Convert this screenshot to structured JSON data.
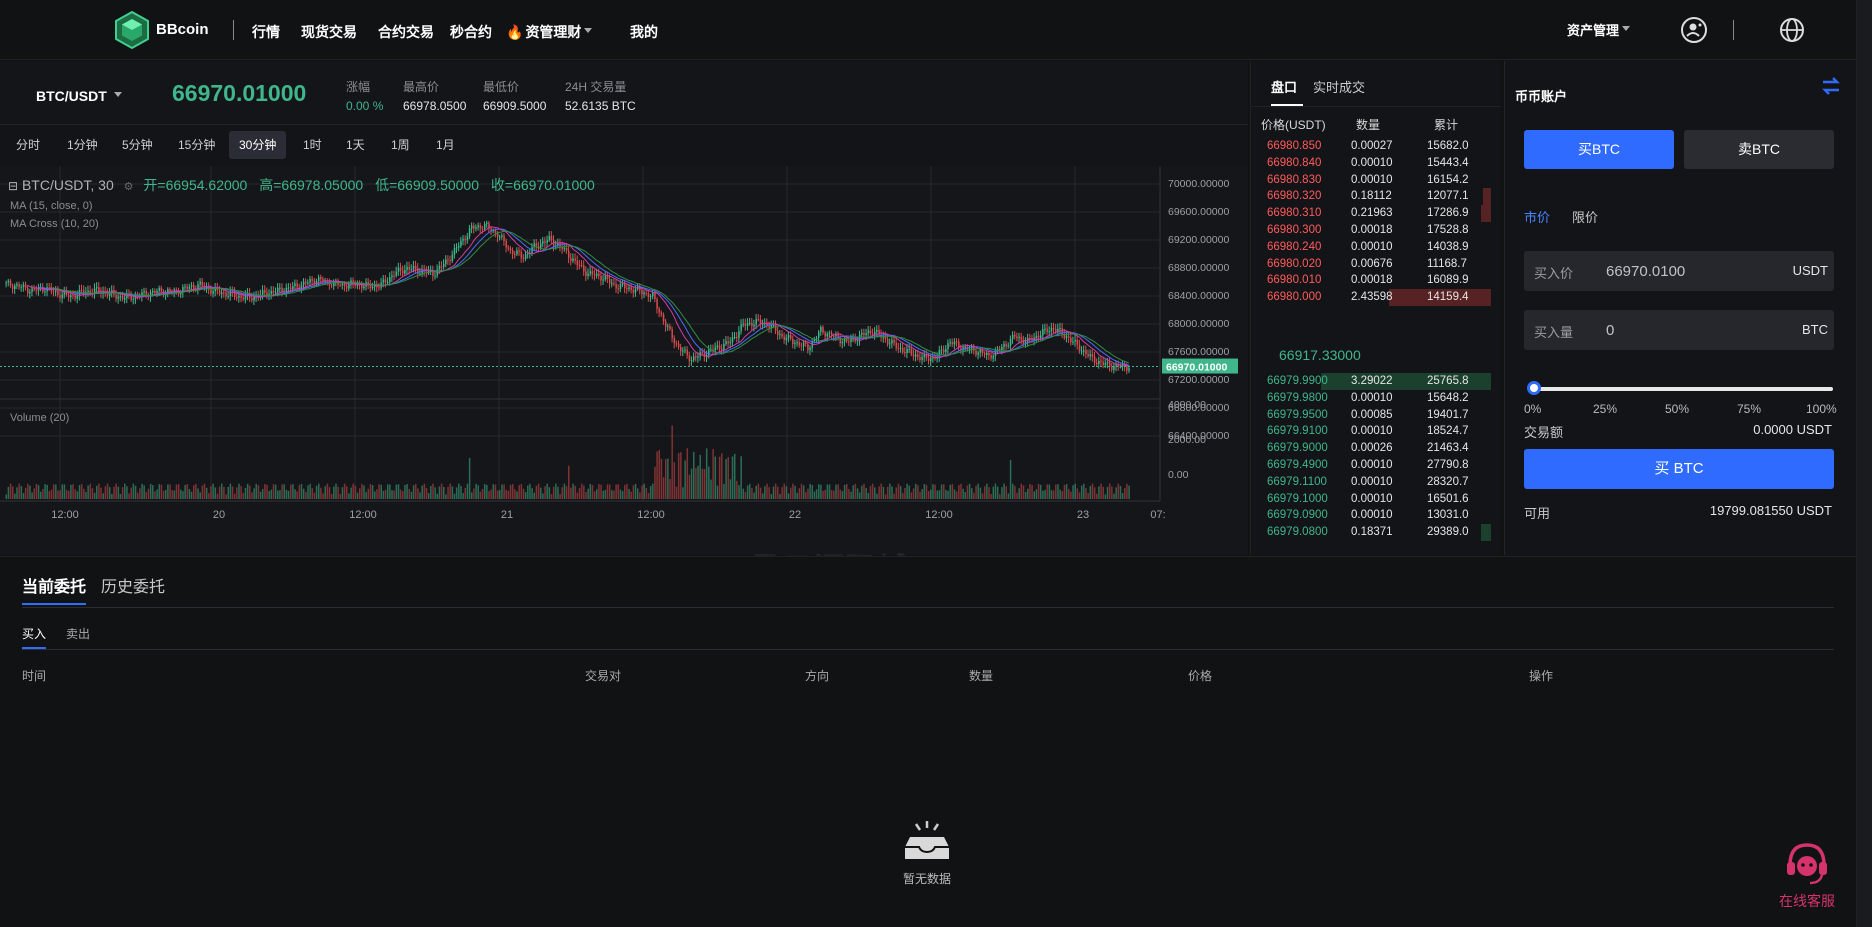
{
  "colors": {
    "up": "#3fb68b",
    "down": "#ff5b5b",
    "accent": "#2f6bff",
    "support": "#d6336c"
  },
  "nav": {
    "brand": "BBcoin",
    "items": [
      "行情",
      "现货交易",
      "合约交易",
      "秒合约",
      "资管理财",
      "我的"
    ],
    "asset_menu": "资产管理"
  },
  "ticker": {
    "pair": "BTC/USDT",
    "last_price": "66970.01000",
    "change_label": "涨幅",
    "change_value": "0.00 %",
    "high_label": "最高价",
    "high_value": "66978.0500",
    "low_label": "最低价",
    "low_value": "66909.5000",
    "vol_label": "24H 交易量",
    "vol_value": "52.6135 BTC"
  },
  "intervals": [
    "分时",
    "1分钟",
    "5分钟",
    "15分钟",
    "30分钟",
    "1时",
    "1天",
    "1周",
    "1月"
  ],
  "active_interval": "30分钟",
  "chart": {
    "legend_symbol": "BTC/USDT, 30",
    "open": "开=66954.62000",
    "high": "高=66978.05000",
    "low": "低=66909.50000",
    "close": "收=66970.01000",
    "ma_line": "MA (15, close, 0)",
    "ma_cross": "MA Cross (10, 20)",
    "volume_label": "Volume (20)",
    "price_ticks": [
      "70000.00000",
      "69600.00000",
      "69200.00000",
      "68800.00000",
      "68400.00000",
      "68000.00000",
      "67600.00000",
      "67200.00000",
      "66800.00000",
      "66400.00000"
    ],
    "last_tag": "66970.01000",
    "volume_ticks": [
      "4000.00",
      "2000.00",
      "0.00"
    ],
    "time_ticks": [
      "12:00",
      "20",
      "12:00",
      "21",
      "12:00",
      "22",
      "12:00",
      "23",
      "07:"
    ],
    "watermark": "星云源码城  fjinguo.com"
  },
  "chart_data": {
    "type": "candlestick",
    "title": "BTC/USDT, 30",
    "ylim": [
      66400,
      70000
    ],
    "x_ticks": [
      "12:00",
      "20",
      "12:00",
      "21",
      "12:00",
      "22",
      "12:00",
      "23",
      "07:"
    ],
    "close_path": [
      68420,
      68380,
      68300,
      68350,
      68250,
      68200,
      68280,
      68300,
      68250,
      68180,
      68200,
      68260,
      68300,
      68280,
      68350,
      68400,
      68300,
      68250,
      68200,
      68180,
      68250,
      68300,
      68350,
      68420,
      68500,
      68450,
      68400,
      68420,
      68380,
      68400,
      68600,
      68700,
      68650,
      68600,
      68800,
      69100,
      69400,
      69450,
      69300,
      69000,
      68900,
      69100,
      69200,
      69050,
      68800,
      68600,
      68550,
      68400,
      68350,
      68300,
      68200,
      67700,
      67300,
      67100,
      67200,
      67300,
      67400,
      67700,
      67750,
      67700,
      67500,
      67400,
      67300,
      67600,
      67500,
      67400,
      67500,
      67600,
      67450,
      67300,
      67200,
      67100,
      67150,
      67400,
      67300,
      67250,
      67150,
      67300,
      67500,
      67400,
      67550,
      67650,
      67500,
      67300,
      67100,
      67000,
      66970
    ],
    "volume_ylim": [
      0,
      4000
    ]
  },
  "book": {
    "tabs": [
      "盘口",
      "实时成交"
    ],
    "headers": [
      "价格(USDT)",
      "数量",
      "累计"
    ],
    "asks": [
      {
        "p": "66980.850",
        "q": "0.00027",
        "t": "15682.0",
        "d": 0
      },
      {
        "p": "66980.840",
        "q": "0.00010",
        "t": "15443.4",
        "d": 0
      },
      {
        "p": "66980.830",
        "q": "0.00010",
        "t": "16154.2",
        "d": 0
      },
      {
        "p": "66980.320",
        "q": "0.18112",
        "t": "12077.1",
        "d": 0.05
      },
      {
        "p": "66980.310",
        "q": "0.21963",
        "t": "17286.9",
        "d": 0.06
      },
      {
        "p": "66980.300",
        "q": "0.00018",
        "t": "17528.8",
        "d": 0
      },
      {
        "p": "66980.240",
        "q": "0.00010",
        "t": "14038.9",
        "d": 0
      },
      {
        "p": "66980.020",
        "q": "0.00676",
        "t": "11168.7",
        "d": 0
      },
      {
        "p": "66980.010",
        "q": "0.00018",
        "t": "16089.9",
        "d": 0
      },
      {
        "p": "66980.000",
        "q": "2.43598",
        "t": "14159.4",
        "d": 0.6
      }
    ],
    "mid": "66917.33000",
    "bids": [
      {
        "p": "66979.9900",
        "q": "3.29022",
        "t": "25765.8",
        "d": 1.0
      },
      {
        "p": "66979.9800",
        "q": "0.00010",
        "t": "15648.2",
        "d": 0
      },
      {
        "p": "66979.9500",
        "q": "0.00085",
        "t": "19401.7",
        "d": 0
      },
      {
        "p": "66979.9100",
        "q": "0.00010",
        "t": "18524.7",
        "d": 0
      },
      {
        "p": "66979.9000",
        "q": "0.00026",
        "t": "21463.4",
        "d": 0
      },
      {
        "p": "66979.4900",
        "q": "0.00010",
        "t": "27790.8",
        "d": 0
      },
      {
        "p": "66979.1100",
        "q": "0.00010",
        "t": "28320.7",
        "d": 0
      },
      {
        "p": "66979.1000",
        "q": "0.00010",
        "t": "16501.6",
        "d": 0
      },
      {
        "p": "66979.0900",
        "q": "0.00010",
        "t": "13031.0",
        "d": 0
      },
      {
        "p": "66979.0800",
        "q": "0.18371",
        "t": "29389.0",
        "d": 0.06
      }
    ]
  },
  "trade": {
    "title": "币币账户",
    "buy_label": "买BTC",
    "sell_label": "卖BTC",
    "market_label": "市价",
    "limit_label": "限价",
    "price_label": "买入价",
    "price_value": "66970.0100",
    "price_unit": "USDT",
    "amount_label": "买入量",
    "amount_value": "0",
    "amount_unit": "BTC",
    "slider_value": 0,
    "percents": [
      "0%",
      "25%",
      "50%",
      "75%",
      "100%"
    ],
    "volume_label": "交易额",
    "volume_value": "0.0000 USDT",
    "submit_label": "买 BTC",
    "available_label": "可用",
    "available_value": "19799.081550 USDT"
  },
  "orders": {
    "tabs": [
      "当前委托",
      "历史委托"
    ],
    "sub_tabs": [
      "买入",
      "卖出"
    ],
    "columns": [
      "时间",
      "交易对",
      "方向",
      "数量",
      "价格",
      "操作"
    ],
    "empty_text": "暂无数据",
    "support_text": "在线客服"
  }
}
